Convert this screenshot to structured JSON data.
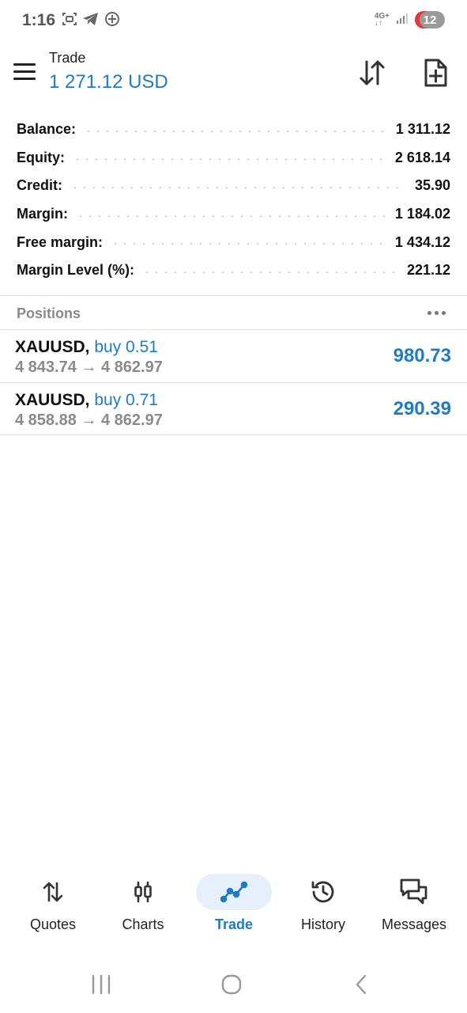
{
  "status_bar": {
    "time": "1:16",
    "network": "4G+",
    "battery": "12",
    "icons_left": [
      "screenshot-icon",
      "telegram-icon",
      "location-icon"
    ],
    "icons_right": [
      "network-icon",
      "signal-icon",
      "battery-icon"
    ]
  },
  "header": {
    "title": "Trade",
    "balance": "1 271.12 USD",
    "accent": "#1f7bc2",
    "buttons": [
      "sort-icon",
      "new-order-icon"
    ]
  },
  "summary": [
    {
      "label": "Balance:",
      "value": "1 311.12"
    },
    {
      "label": "Equity:",
      "value": "2 618.14"
    },
    {
      "label": "Credit:",
      "value": "35.90"
    },
    {
      "label": "Margin:",
      "value": "1 184.02"
    },
    {
      "label": "Free margin:",
      "value": "1 434.12"
    },
    {
      "label": "Margin Level (%):",
      "value": "221.12"
    }
  ],
  "positions": {
    "title": "Positions",
    "items": [
      {
        "symbol": "XAUUSD,",
        "side": "buy 0.51",
        "prices": "4 843.74 → 4 862.97",
        "profit": "980.73"
      },
      {
        "symbol": "XAUUSD,",
        "side": "buy 0.71",
        "prices": "4 858.88 → 4 862.97",
        "profit": "290.39"
      }
    ]
  },
  "bottom_nav": [
    {
      "label": "Quotes",
      "icon": "quotes-icon",
      "active": false
    },
    {
      "label": "Charts",
      "icon": "charts-icon",
      "active": false
    },
    {
      "label": "Trade",
      "icon": "trade-icon",
      "active": true
    },
    {
      "label": "History",
      "icon": "history-icon",
      "active": false
    },
    {
      "label": "Messages",
      "icon": "messages-icon",
      "active": false
    }
  ],
  "system_nav": [
    "recent-apps-icon",
    "home-icon",
    "back-icon"
  ]
}
